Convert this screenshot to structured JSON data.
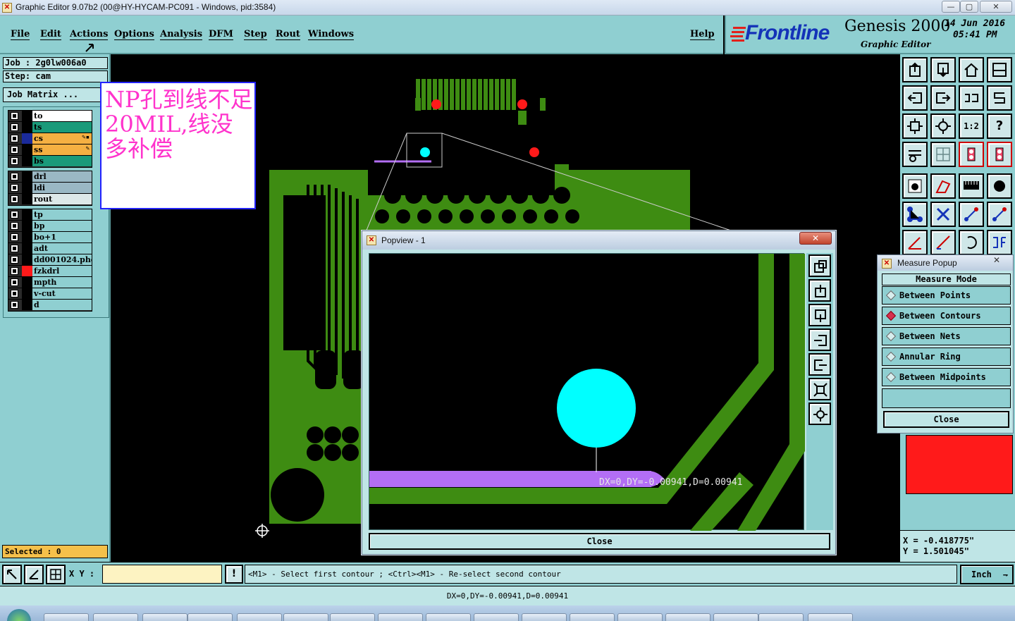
{
  "window": {
    "title": "Graphic Editor 9.07b2 (00@HY-HYCAM-PC091 - Windows, pid:3584)",
    "min": "—",
    "max": "▢",
    "close": "✕"
  },
  "menu": [
    "File",
    "Edit",
    "Actions",
    "Options",
    "Analysis",
    "DFM",
    "Step",
    "Rout",
    "Windows"
  ],
  "help": "Help",
  "logo": {
    "brand": "Frontline",
    "product": "Genesis 2000",
    "subtitle": "Graphic Editor",
    "date": "14 Jun 2016",
    "time": "05:41 PM"
  },
  "job": {
    "job_line": "Job : 2g0lw006a0",
    "step_line": "Step: cam",
    "matrix_btn": "Job Matrix ..."
  },
  "layers": {
    "group1": [
      {
        "name": "to",
        "color": "#ffffff"
      },
      {
        "name": "ts",
        "color": "#1a9a7a"
      },
      {
        "name": "cs",
        "color": "#f5b042",
        "locked": true
      },
      {
        "name": "ss",
        "color": "#f5b042",
        "locked": true
      },
      {
        "name": "bs",
        "color": "#1a9a7a"
      }
    ],
    "group2": [
      {
        "name": "drl",
        "color": "#9ab8c4"
      },
      {
        "name": "ldi",
        "color": "#9ab8c4"
      },
      {
        "name": "rout",
        "color": "#dde8e8"
      }
    ],
    "group3": [
      {
        "name": "tp",
        "color": "#8fcfd1"
      },
      {
        "name": "bp",
        "color": "#8fcfd1"
      },
      {
        "name": "bo+1",
        "color": "#8fcfd1"
      },
      {
        "name": "adt",
        "color": "#8fcfd1"
      },
      {
        "name": "dd001024.pho",
        "color": "#8fcfd1"
      },
      {
        "name": "fzkdrl",
        "color": "#8fcfd1"
      },
      {
        "name": "mpth",
        "color": "#8fcfd1"
      },
      {
        "name": "v-cut",
        "color": "#8fcfd1"
      },
      {
        "name": "d",
        "color": "#8fcfd1"
      }
    ]
  },
  "selected": "Selected : 0",
  "annotation": "NP孔到线不足20MIL,线没多补偿",
  "colors": {
    "board": "#3e8c12",
    "cyan": "#00ffff",
    "purple": "#b36ef5",
    "red": "#ff1a1a",
    "panel": "#8fcfd1"
  },
  "popview": {
    "title": "Popview - 1",
    "measure_label": "DX=0,DY=-0.00941,D=0.00941",
    "close": "Close"
  },
  "measure": {
    "title": "Measure Popup",
    "mode_label": "Measure Mode",
    "options": [
      "Between Points",
      "Between Contours",
      "Between Nets",
      "Annular Ring",
      "Between Midpoints"
    ],
    "selected_index": 1,
    "close": "Close"
  },
  "coords": {
    "x": "X = -0.418775\"",
    "y": "Y = 1.501045\""
  },
  "status": {
    "xy_label": "X Y :",
    "xy_value": "",
    "prompt": "<M1> - Select first contour ; <Ctrl><M1> - Re-select second contour",
    "units": "Inch"
  },
  "message": "DX=0,DY=-0.00941,D=0.00941"
}
